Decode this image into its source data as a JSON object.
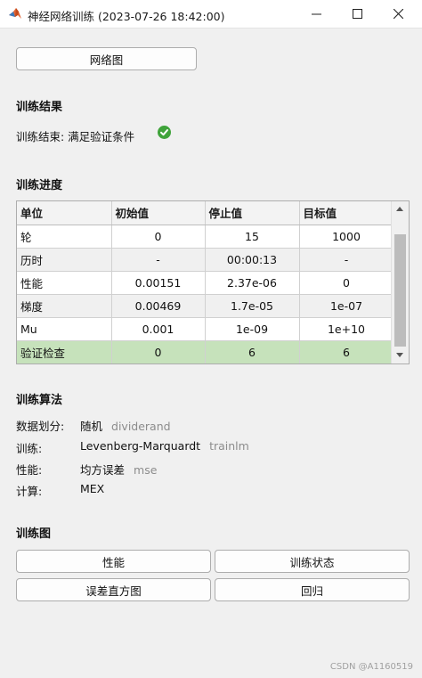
{
  "window": {
    "title": "神经网络训练 (2023-07-26 18:42:00)",
    "icon": "matlab-icon"
  },
  "toolbar": {
    "network_button": "网络图"
  },
  "results": {
    "heading": "训练结果",
    "status": "训练结束: 满足验证条件",
    "status_icon": "check-circle-icon",
    "status_color": "#3fa33a"
  },
  "progress": {
    "heading": "训练进度",
    "columns": [
      "单位",
      "初始值",
      "停止值",
      "目标值"
    ],
    "rows": [
      [
        "轮",
        "0",
        "15",
        "1000"
      ],
      [
        "历时",
        "-",
        "00:00:13",
        "-"
      ],
      [
        "性能",
        "0.00151",
        "2.37e-06",
        "0"
      ],
      [
        "梯度",
        "0.00469",
        "1.7e-05",
        "1e-07"
      ],
      [
        "Mu",
        "0.001",
        "1e-09",
        "1e+10"
      ],
      [
        "验证检查",
        "0",
        "6",
        "6"
      ]
    ],
    "highlight_color": "#c6e2bb"
  },
  "algorithms": {
    "heading": "训练算法",
    "items": [
      {
        "label": "数据划分:",
        "value": "随机",
        "fn": "dividerand"
      },
      {
        "label": "训练:",
        "value": "Levenberg-Marquardt",
        "fn": "trainlm"
      },
      {
        "label": "性能:",
        "value": "均方误差",
        "fn": "mse"
      },
      {
        "label": "计算:",
        "value": "MEX",
        "fn": ""
      }
    ]
  },
  "plots": {
    "heading": "训练图",
    "buttons": [
      "性能",
      "训练状态",
      "误差直方图",
      "回归"
    ]
  },
  "watermark": "CSDN @A1160519"
}
